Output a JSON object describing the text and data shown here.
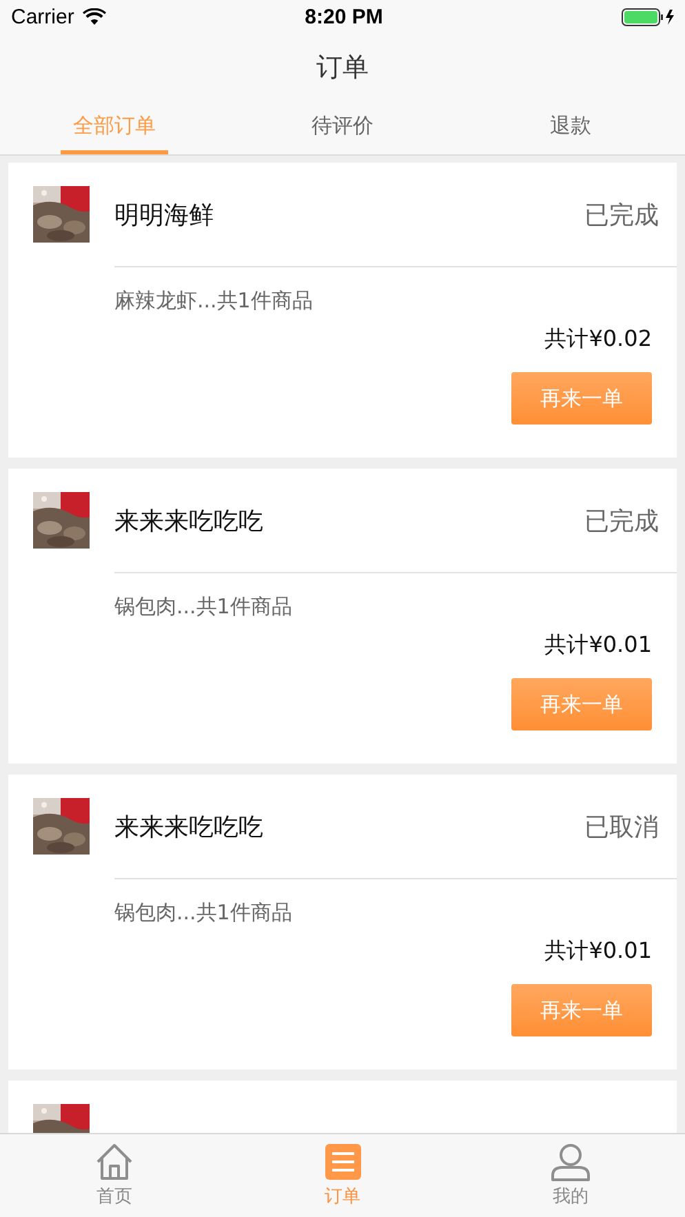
{
  "status_bar": {
    "carrier": "Carrier",
    "time": "8:20 PM"
  },
  "nav": {
    "title": "订单"
  },
  "tabs": [
    {
      "label": "全部订单",
      "selected": true
    },
    {
      "label": "待评价",
      "selected": false
    },
    {
      "label": "退款",
      "selected": false
    }
  ],
  "orders": [
    {
      "shop": "明明海鲜",
      "status": "已完成",
      "summary": "麻辣龙虾...共1件商品",
      "total": "共计¥0.02",
      "button": "再来一单",
      "avatar": {
        "kind": "picture"
      }
    },
    {
      "shop": "来来来吃吃吃",
      "status": "已完成",
      "summary": "锅包肉...共1件商品",
      "total": "共计¥0.01",
      "button": "再来一单",
      "avatar": {
        "kind": "picture"
      }
    },
    {
      "shop": "来来来吃吃吃",
      "status": "已取消",
      "summary": "锅包肉...共1件商品",
      "total": "共计¥0.01",
      "button": "再来一单",
      "avatar": {
        "kind": "picture"
      }
    },
    {
      "avatar": {
        "kind": "picture"
      }
    }
  ],
  "tab_bar": [
    {
      "kind": "home",
      "label": "首页",
      "selected": false
    },
    {
      "kind": "orders",
      "label": "订单",
      "selected": true
    },
    {
      "kind": "profile",
      "label": "我的",
      "selected": false
    }
  ]
}
